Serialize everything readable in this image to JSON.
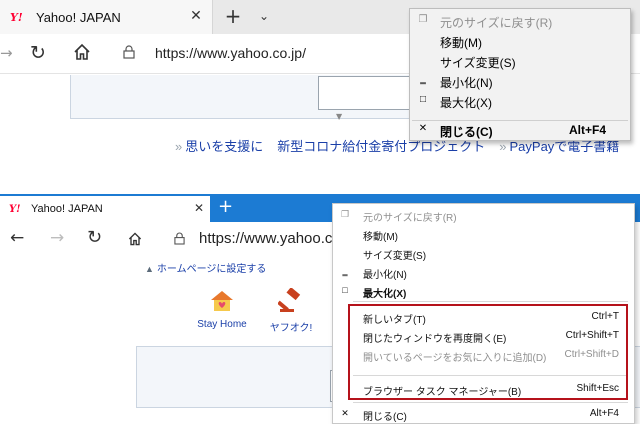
{
  "top": {
    "tab": {
      "title": "Yahoo! JAPAN",
      "favicon": "Y!"
    },
    "toolbar": {
      "url": "https://www.yahoo.co.jp/"
    },
    "links": [
      "思いを支援に",
      "新型コロナ給付金寄付プロジェクト",
      "PayPayで電子書籍"
    ],
    "menu": {
      "items": [
        {
          "icon": "restore-icon",
          "glyph": "❐",
          "label": "元のサイズに戻す(R)",
          "key": "",
          "disabled": true,
          "bold": false
        },
        {
          "icon": "",
          "glyph": "",
          "label": "移動(M)",
          "key": "",
          "disabled": false,
          "bold": false
        },
        {
          "icon": "",
          "glyph": "",
          "label": "サイズ変更(S)",
          "key": "",
          "disabled": false,
          "bold": false
        },
        {
          "icon": "minimize-icon",
          "glyph": "‗",
          "label": "最小化(N)",
          "key": "",
          "disabled": false,
          "bold": false
        },
        {
          "icon": "maximize-icon",
          "glyph": "□",
          "label": "最大化(X)",
          "key": "",
          "disabled": false,
          "bold": false
        },
        {
          "icon": "close-icon",
          "glyph": "✕",
          "label": "閉じる(C)",
          "key": "Alt+F4",
          "disabled": false,
          "bold": true
        }
      ]
    }
  },
  "bottom": {
    "tab": {
      "title": "Yahoo! JAPAN",
      "favicon": "Y!"
    },
    "toolbar": {
      "url": "https://www.yahoo.co"
    },
    "homeset": "ホームページに設定する",
    "shortcuts": [
      {
        "label": "Stay Home"
      },
      {
        "label": "ヤフオク!"
      }
    ],
    "menu": {
      "items": [
        {
          "glyph": "❐",
          "label": "元のサイズに戻す(R)",
          "key": "",
          "disabled": true,
          "bold": false
        },
        {
          "glyph": "",
          "label": "移動(M)",
          "key": "",
          "disabled": false,
          "bold": false
        },
        {
          "glyph": "",
          "label": "サイズ変更(S)",
          "key": "",
          "disabled": false,
          "bold": false
        },
        {
          "glyph": "‗",
          "label": "最小化(N)",
          "key": "",
          "disabled": false,
          "bold": false
        },
        {
          "glyph": "□",
          "label": "最大化(X)",
          "key": "",
          "disabled": false,
          "bold": true
        },
        {
          "glyph": "",
          "label": "新しいタブ(T)",
          "key": "Ctrl+T",
          "disabled": false,
          "bold": false
        },
        {
          "glyph": "",
          "label": "閉じたウィンドウを再度開く(E)",
          "key": "Ctrl+Shift+T",
          "disabled": false,
          "bold": false
        },
        {
          "glyph": "",
          "label": "開いているページをお気に入りに追加(D)",
          "key": "Ctrl+Shift+D",
          "disabled": true,
          "bold": false
        },
        {
          "glyph": "",
          "label": "ブラウザー タスク マネージャー(B)",
          "key": "Shift+Esc",
          "disabled": false,
          "bold": false
        },
        {
          "glyph": "✕",
          "label": "閉じる(C)",
          "key": "Alt+F4",
          "disabled": false,
          "bold": false
        }
      ]
    }
  },
  "colors": {
    "edge_blue": "#1c7bd3",
    "highlight_red": "#b5121b",
    "link_blue": "#1a3fa8",
    "yahoo_red": "#ff0033"
  }
}
